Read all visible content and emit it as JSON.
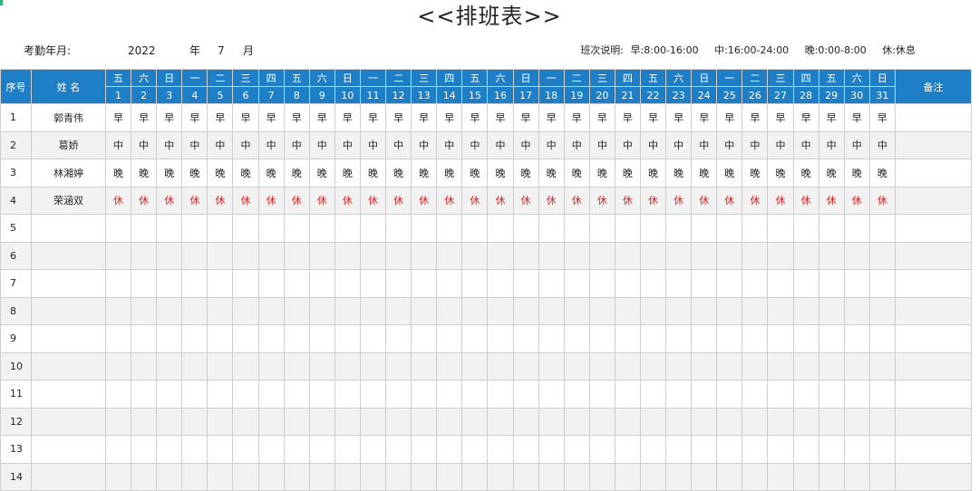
{
  "title": "<<排班表>>",
  "header": {
    "month_label": "考勤年月:",
    "year": "2022",
    "year_unit": "年",
    "month": "7",
    "month_unit": "月"
  },
  "legend": {
    "label": "班次说明:",
    "items": [
      "早:8:00-16:00",
      "中:16:00-24:00",
      "晚:0:00-8:00",
      "休:休息"
    ]
  },
  "table": {
    "col_index": "序号",
    "col_name": "姓 名",
    "col_note": "备注",
    "weekdays": [
      "五",
      "六",
      "日",
      "一",
      "二",
      "三",
      "四",
      "五",
      "六",
      "日",
      "一",
      "二",
      "三",
      "四",
      "五",
      "六",
      "日",
      "一",
      "二",
      "三",
      "四",
      "五",
      "六",
      "日",
      "一",
      "二",
      "三",
      "四",
      "五",
      "六",
      "日"
    ],
    "dates": [
      "1",
      "2",
      "3",
      "4",
      "5",
      "6",
      "7",
      "8",
      "9",
      "10",
      "11",
      "12",
      "13",
      "14",
      "15",
      "16",
      "17",
      "18",
      "19",
      "20",
      "21",
      "22",
      "23",
      "24",
      "25",
      "26",
      "27",
      "28",
      "29",
      "30",
      "31"
    ],
    "rows": [
      {
        "index": "1",
        "name": "郭青伟",
        "shift": "早"
      },
      {
        "index": "2",
        "name": "葛娇",
        "shift": "中"
      },
      {
        "index": "3",
        "name": "林湘婷",
        "shift": "晚"
      },
      {
        "index": "4",
        "name": "荣涵双",
        "shift": "休"
      },
      {
        "index": "5",
        "name": "",
        "shift": ""
      },
      {
        "index": "6",
        "name": "",
        "shift": ""
      },
      {
        "index": "7",
        "name": "",
        "shift": ""
      },
      {
        "index": "8",
        "name": "",
        "shift": ""
      },
      {
        "index": "9",
        "name": "",
        "shift": ""
      },
      {
        "index": "10",
        "name": "",
        "shift": ""
      },
      {
        "index": "11",
        "name": "",
        "shift": ""
      },
      {
        "index": "12",
        "name": "",
        "shift": ""
      },
      {
        "index": "13",
        "name": "",
        "shift": ""
      },
      {
        "index": "14",
        "name": "",
        "shift": ""
      }
    ]
  },
  "colors": {
    "header_blue": "#1e7fc6",
    "rest_red": "#e02020"
  }
}
